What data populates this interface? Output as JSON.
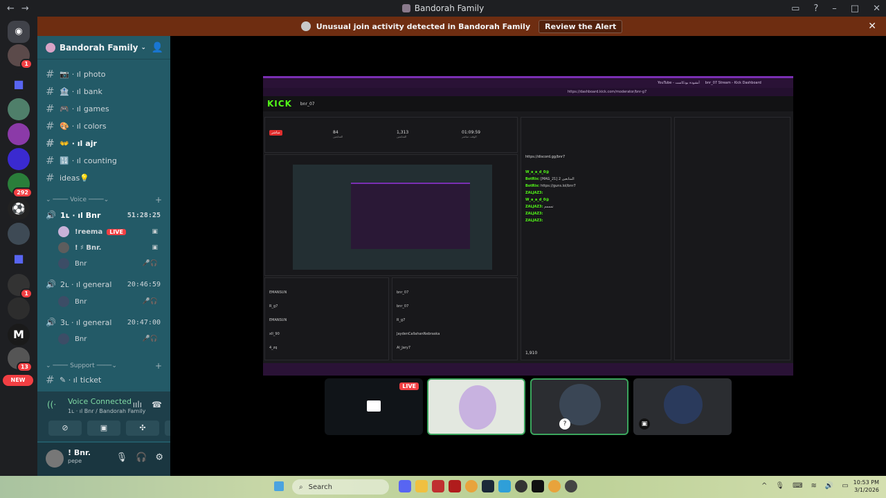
{
  "window": {
    "title": "Bandorah Family"
  },
  "alert": {
    "text": "Unusual join activity detected in Bandorah Family",
    "action": "Review the Alert"
  },
  "rail": {
    "badges": [
      "1",
      "292",
      "1",
      "13"
    ],
    "new_label": "NEW"
  },
  "server": {
    "name": "Bandorah Family"
  },
  "channels": [
    {
      "emoji": "📷",
      "name": "photo"
    },
    {
      "emoji": "🏦",
      "name": "bank"
    },
    {
      "emoji": "🎮",
      "name": "games"
    },
    {
      "emoji": "🎨",
      "name": "colors"
    },
    {
      "emoji": "👐",
      "name": "ajr"
    },
    {
      "emoji": "🔢",
      "name": "counting"
    },
    {
      "emoji": "💡",
      "name": "ideas"
    }
  ],
  "voice_category": "Voice",
  "voice_channels": [
    {
      "name": "1ʟ · ıl Bnr",
      "time": "51:28:25"
    },
    {
      "name": "2ʟ · ıl general",
      "time": "20:46:59"
    },
    {
      "name": "3ʟ · ıl general",
      "time": "20:47:00"
    }
  ],
  "voice_users": [
    {
      "name": "!reema",
      "live": "LIVE"
    },
    {
      "name": "! ♯ Bnr."
    },
    {
      "name": "Bnr"
    },
    {
      "name": "Bnr"
    },
    {
      "name": "Bnr"
    }
  ],
  "support_category": "Support",
  "support_channel": "ticket",
  "voice_connected": {
    "status": "Voice Connected",
    "location": "1ʟ · ıl Bnr / Bandorah Family"
  },
  "user": {
    "name": "! Bnr.",
    "status": "pepe"
  },
  "stream": {
    "tabs": [
      "YouTube - أنشودة بودكاست",
      "bnr_07 Stream - Kick Dashboard"
    ],
    "url": "https://dashboard.kick.com/moderator/bnr-g7",
    "logo": "KICK",
    "channel": "bnr_07",
    "stats": [
      {
        "value": "84",
        "label": "المتابعين"
      },
      {
        "value": "1,313",
        "label": "المتابعين"
      },
      {
        "value": "01:09:59",
        "label": "الوقت مباشر"
      }
    ],
    "live_label": "مباشر",
    "chat_link": "https://discord.gg/bnr7",
    "chat_lines": [
      {
        "user": "W_a_a_d_0@",
        "text": ""
      },
      {
        "user": "BotRix:",
        "text": "[MAG_21] 2 المتابعين"
      },
      {
        "user": "BotRix:",
        "text": "https://guns.lol/bnr7"
      },
      {
        "user": "ZALJAZ3:",
        "text": ""
      },
      {
        "user": "W_a_a_d_0@",
        "text": ""
      },
      {
        "user": "ZALJAZ3:",
        "text": "تمممم"
      },
      {
        "user": "ZALJAZ3:",
        "text": ""
      },
      {
        "user": "ZALJAZ3:",
        "text": ""
      }
    ],
    "follow_list": [
      "EMANSUN",
      "R_g7",
      "EMANSUN",
      "xII_90",
      "4_zq"
    ],
    "sub_list": [
      "bnr_07",
      "bnr_07",
      "R_g7",
      "JaydenCallahanNebraska",
      "Al_Jary7"
    ],
    "viewer_count": "1,910"
  },
  "taskbar": {
    "search": "Search",
    "time": "10:53 PM",
    "date": "3/1/2026"
  }
}
